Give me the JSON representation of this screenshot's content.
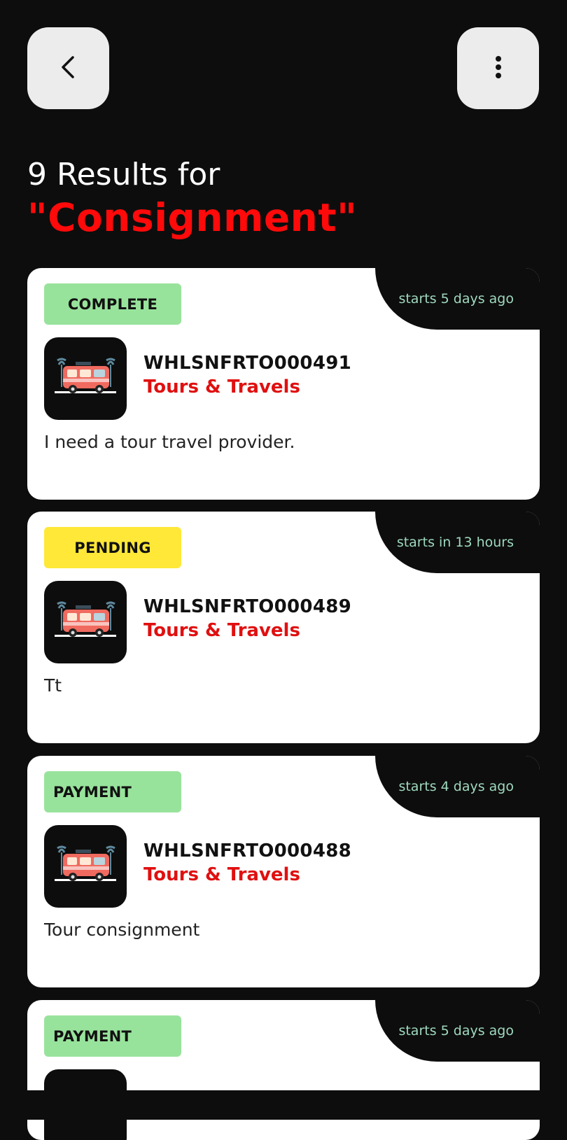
{
  "header": {
    "results_line": "9 Results for",
    "query": "\"Consignment\""
  },
  "icons": {
    "back": "chevron-left-icon",
    "menu": "more-vertical-icon"
  },
  "colors": {
    "background": "#0d0d0d",
    "accent_red": "#ff0a0a",
    "status_complete": "#98e39c",
    "status_pending": "#ffe838",
    "status_payment": "#98e39c",
    "time_text": "#9fd9bf"
  },
  "cards": [
    {
      "status": "COMPLETE",
      "status_color": "#98e39c",
      "time": "starts 5 days ago",
      "code": "WHLSNFRTO000491",
      "category": "Tours & Travels",
      "description": "I need a tour travel provider."
    },
    {
      "status": "PENDING",
      "status_color": "#ffe838",
      "time": "starts in 13 hours",
      "code": "WHLSNFRTO000489",
      "category": "Tours & Travels",
      "description": "Tt"
    },
    {
      "status": "PAYMENT",
      "status_color": "#98e39c",
      "time": "starts 4 days ago",
      "code": "WHLSNFRTO000488",
      "category": "Tours & Travels",
      "description": "Tour consignment"
    },
    {
      "status": "PAYMENT",
      "status_color": "#98e39c",
      "time": "starts 5 days ago"
    }
  ]
}
